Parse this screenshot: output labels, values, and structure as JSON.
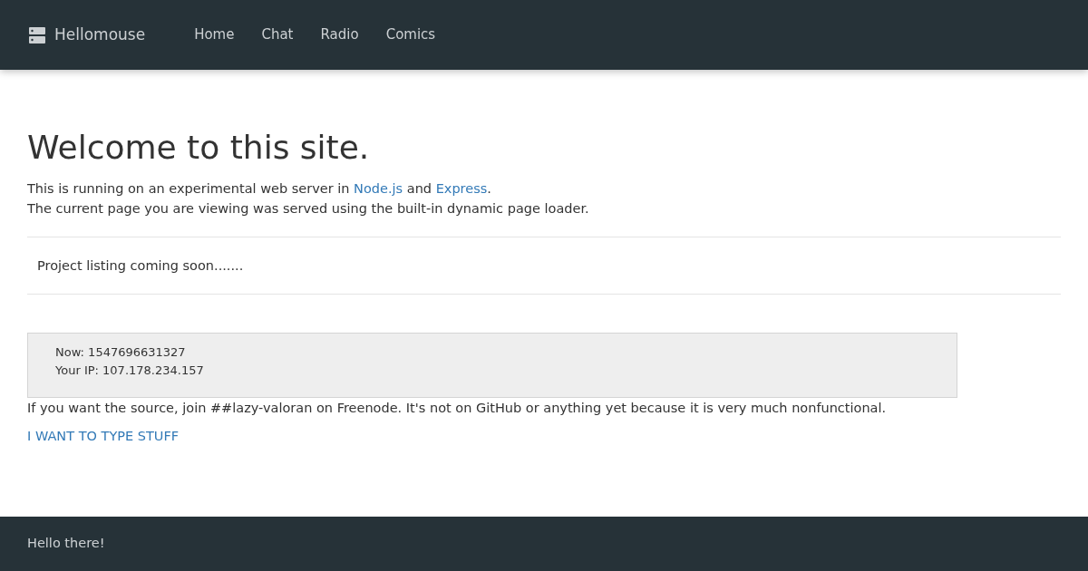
{
  "navbar": {
    "brand": "Hellomouse",
    "links": [
      {
        "label": "Home"
      },
      {
        "label": "Chat"
      },
      {
        "label": "Radio"
      },
      {
        "label": "Comics"
      }
    ]
  },
  "heading": "Welcome to this site.",
  "intro": [
    [
      {
        "kind": "text",
        "text": "This is running on an experimental web server in "
      },
      {
        "kind": "link",
        "text": "Node.js"
      },
      {
        "kind": "text",
        "text": " and "
      },
      {
        "kind": "link",
        "text": "Express"
      },
      {
        "kind": "text",
        "text": "."
      }
    ],
    [
      {
        "kind": "text",
        "text": "The current page you are viewing was served using the built-in dynamic page loader."
      }
    ]
  ],
  "project_listing": "Project listing coming soon.......",
  "info_box": [
    "Now: 1547696631327",
    "Your IP: 107.178.234.157"
  ],
  "source_note": "If you want the source, join ##lazy-valoran on Freenode. It's not on GitHub or anything yet because it is very much nonfunctional.",
  "type_link": "I WANT TO TYPE STUFF",
  "footer": "Hello there!"
}
